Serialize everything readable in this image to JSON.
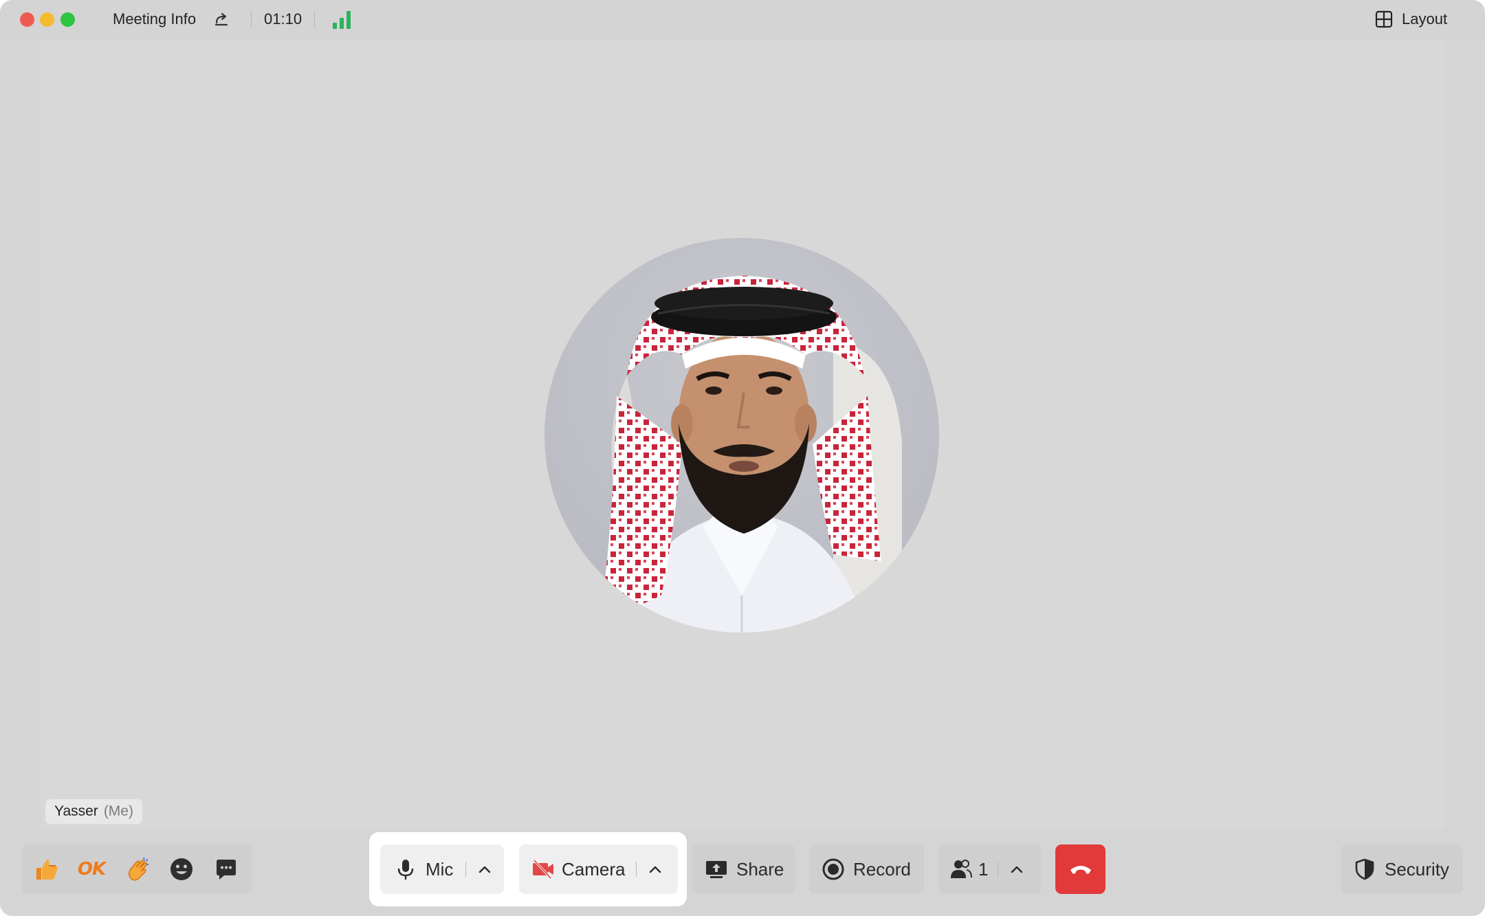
{
  "window": {
    "title": "Meeting Info",
    "timer": "01:10",
    "layout_label": "Layout",
    "signal_color": "#2bb35b"
  },
  "participant": {
    "name": "Yasser",
    "tag": "(Me)"
  },
  "reactions": [
    {
      "name": "thumbs-up",
      "icon": "thumbs-up-icon"
    },
    {
      "name": "ok",
      "label": "OK"
    },
    {
      "name": "clap",
      "icon": "clap-icon"
    },
    {
      "name": "emoji",
      "icon": "emoji-icon"
    },
    {
      "name": "chat",
      "icon": "chat-icon"
    }
  ],
  "controls": {
    "mic_label": "Mic",
    "camera_label": "Camera",
    "share_label": "Share",
    "record_label": "Record",
    "participants_count": "1",
    "security_label": "Security"
  },
  "colors": {
    "end_call": "#e23a3a",
    "camera_off": "#e34848",
    "reaction_orange": "#f07a1a"
  }
}
